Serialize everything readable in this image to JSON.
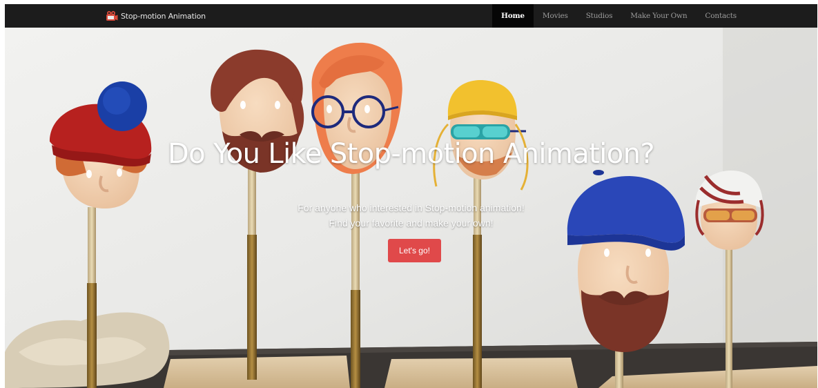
{
  "nav": {
    "brand": "Stop-motion Animation",
    "items": [
      {
        "label": "Home",
        "active": true
      },
      {
        "label": "Movies",
        "active": false
      },
      {
        "label": "Studios",
        "active": false
      },
      {
        "label": "Make Your Own",
        "active": false
      },
      {
        "label": "Contacts",
        "active": false
      }
    ]
  },
  "hero": {
    "title": "Do You Like Stop-motion Animation?",
    "subtitle_line1": "For anyone who interested in Stop-motion animation!",
    "subtitle_line2": "Find your favorite and make your own!",
    "cta_label": "Let's go!"
  },
  "colors": {
    "navbar": "#1c1c1c",
    "nav_active": "#060606",
    "cta": "#e0494a"
  },
  "background": {
    "description_icon": "stop-motion-puppet-heads-photo"
  }
}
